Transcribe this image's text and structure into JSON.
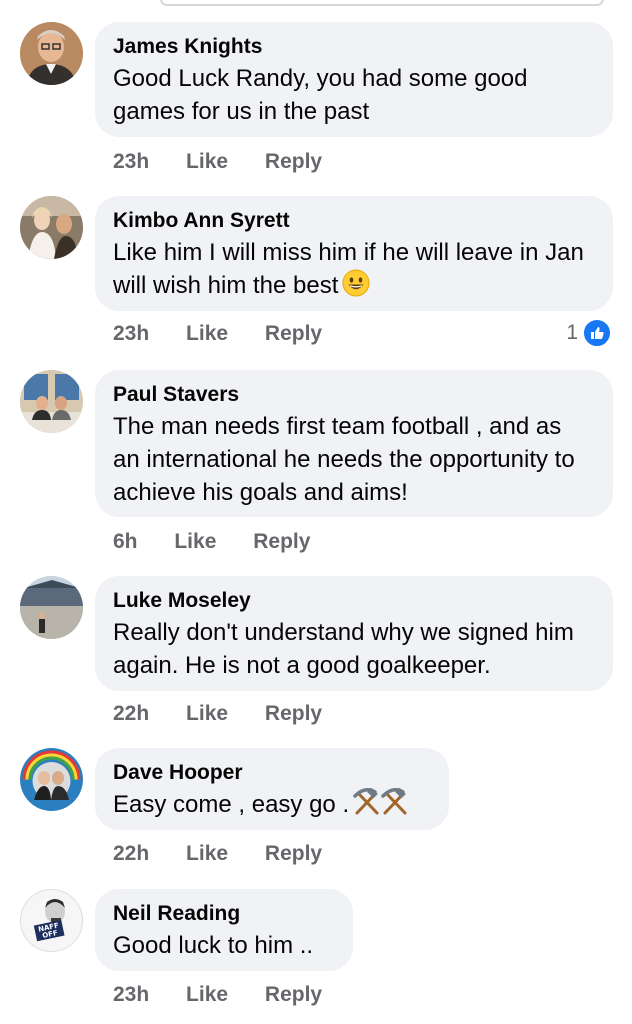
{
  "comments": [
    {
      "author": "James Knights",
      "text": "Good Luck Randy, you had some good games for us in the past",
      "time": "23h",
      "like_label": "Like",
      "reply_label": "Reply"
    },
    {
      "author": "Kimbo Ann Syrett",
      "text": "Like him I will miss him if he will leave in Jan will wish him the best",
      "emoji": "grinning-face-emoji",
      "time": "23h",
      "like_label": "Like",
      "reply_label": "Reply",
      "reaction_count": "1",
      "reaction_type": "like-reaction-icon"
    },
    {
      "author": "Paul Stavers",
      "text": "The man needs first team football , and as an international he needs the opportunity to achieve his goals and aims!",
      "time": "6h",
      "like_label": "Like",
      "reply_label": "Reply"
    },
    {
      "author": "Luke Moseley",
      "text": "Really don't understand why we signed him again. He is not a good goalkeeper.",
      "time": "22h",
      "like_label": "Like",
      "reply_label": "Reply"
    },
    {
      "author": "Dave Hooper",
      "text": "Easy come , easy go .",
      "emoji": "hammer-and-pick-emoji",
      "time": "22h",
      "like_label": "Like",
      "reply_label": "Reply"
    },
    {
      "author": "Neil Reading",
      "text": "Good luck to him ..",
      "time": "23h",
      "like_label": "Like",
      "reply_label": "Reply"
    }
  ],
  "avatar_badge_text": "NAFF OFF",
  "colors": {
    "bubble": "#f0f2f5",
    "meta_text": "#65676b",
    "like_blue": "#1877f2"
  }
}
